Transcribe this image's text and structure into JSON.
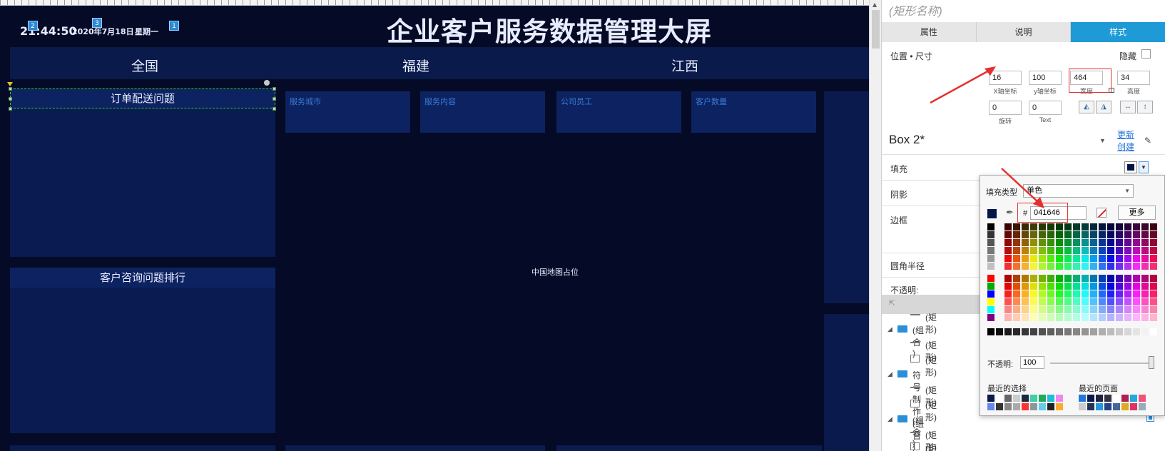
{
  "dashboard": {
    "clock": "21:44:50",
    "date": "2020年7月18日",
    "weekday": "星期一",
    "markers": [
      "2",
      "3",
      "1"
    ],
    "title": "企业客户服务数据管理大屏",
    "regions": [
      "全国",
      "福建",
      "江西"
    ],
    "panels": {
      "order_delivery": "订单配送问题",
      "consult_rank": "客户咨询问题排行"
    },
    "stats": [
      "服务城市",
      "服务内容",
      "公司员工",
      "客户数量"
    ],
    "map_placeholder": "中国地图占位"
  },
  "inspector": {
    "shape_name": "(矩形名称)",
    "tabs": [
      "属性",
      "说明",
      "样式"
    ],
    "active_tab": "样式",
    "position_size_label": "位置 • 尺寸",
    "hide_label": "隐藏",
    "fields": {
      "x": "16",
      "x_label": "X轴坐标",
      "y": "100",
      "y_label": "y轴坐标",
      "width": "464",
      "width_label": "宽度",
      "height": "34",
      "height_label": "高度",
      "rotate": "0",
      "rotate_label": "旋转",
      "text_rotate": "0",
      "text_rotate_label": "Text"
    },
    "object_name": "Box 2*",
    "update_link": "更新",
    "create_link": "创建",
    "sections": [
      "填充",
      "阴影",
      "边框",
      "圆角半径",
      "不透明:"
    ],
    "fill_color": "#041646",
    "layers": [
      {
        "label": "(矩形)",
        "kind": "line"
      },
      {
        "label": "(组合 )",
        "kind": "group"
      },
      {
        "label": "(矩形)",
        "kind": "line"
      },
      {
        "label": "(矩形)",
        "kind": "box"
      },
      {
        "label": "符号制作 (组合 )",
        "kind": "group"
      },
      {
        "label": "(矩形)",
        "kind": "line"
      },
      {
        "label": "(矩形)",
        "kind": "box"
      },
      {
        "label": "(组合 )",
        "kind": "group"
      },
      {
        "label": "(矩形)",
        "kind": "line"
      },
      {
        "label": "(矩形)",
        "kind": "box"
      }
    ]
  },
  "color_picker": {
    "fill_type_label": "填充类型",
    "fill_type_value": "单色",
    "hash": "#",
    "hex_value": "041646",
    "more_label": "更多",
    "opacity_label": "不透明:",
    "opacity_value": "100",
    "recent_colors_label": "最近的选择",
    "recent_pages_label": "最近的页面",
    "annotation_color": "#e53030"
  }
}
